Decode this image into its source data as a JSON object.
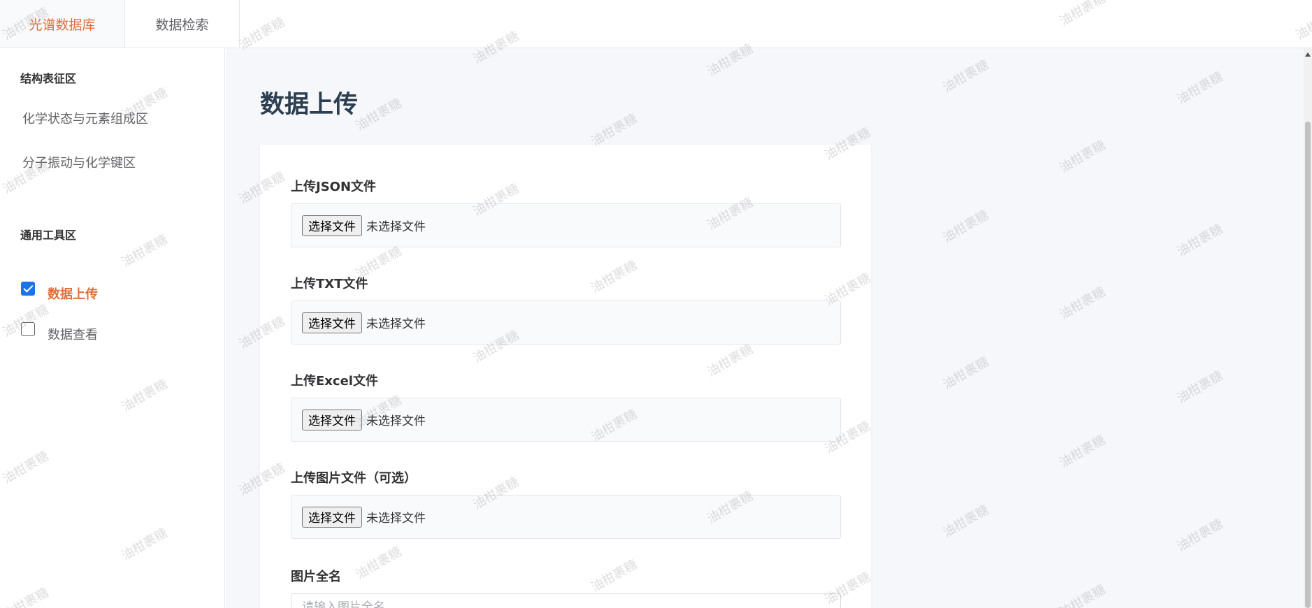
{
  "topnav": {
    "tabs": [
      {
        "label": "光谱数据库",
        "active": true
      },
      {
        "label": "数据检索",
        "active": false
      }
    ]
  },
  "sidebar": {
    "section1_title": "结构表征区",
    "links": [
      "化学状态与元素组成区",
      "分子振动与化学键区"
    ],
    "section2_title": "通用工具区",
    "tools": [
      {
        "label": "数据上传",
        "checked": true
      },
      {
        "label": "数据查看",
        "checked": false
      }
    ]
  },
  "main": {
    "title": "数据上传",
    "fields": [
      {
        "label": "上传JSON文件",
        "button": "选择文件",
        "status": "未选择文件"
      },
      {
        "label": "上传TXT文件",
        "button": "选择文件",
        "status": "未选择文件"
      },
      {
        "label": "上传Excel文件",
        "button": "选择文件",
        "status": "未选择文件"
      },
      {
        "label": "上传图片文件（可选）",
        "button": "选择文件",
        "status": "未选择文件"
      }
    ],
    "image_name": {
      "label": "图片全名",
      "placeholder": "请输入图片全名"
    }
  },
  "watermark": "油柑裹糖",
  "colors": {
    "accent": "#e0703a",
    "checkbox": "#1a73e8",
    "background": "#f5f7fa"
  }
}
